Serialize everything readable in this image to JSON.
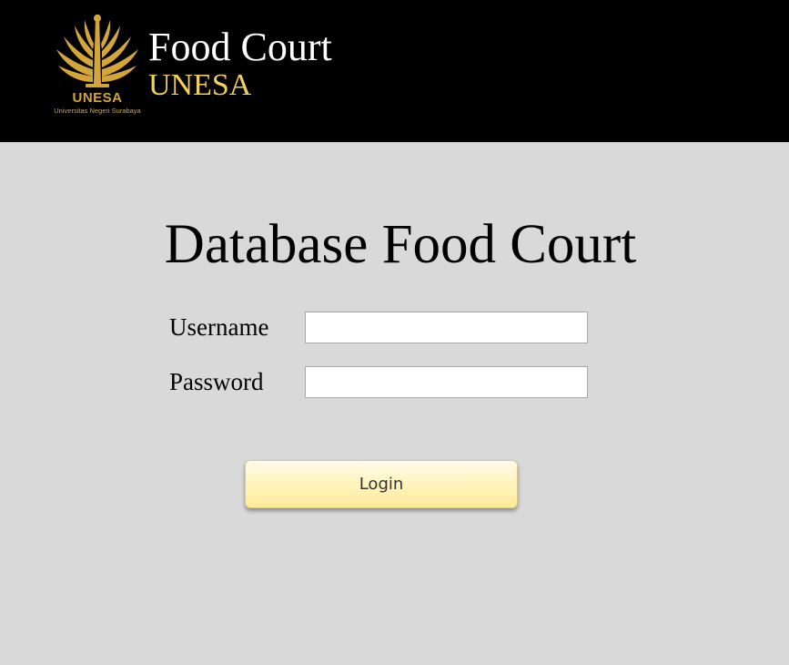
{
  "header": {
    "logo": {
      "icon": "unesa-emblem-icon",
      "wordmark": "UNESA",
      "subtitle": "Universitas Negeri Surabaya",
      "color": "#d4a63a"
    },
    "title": "Food Court",
    "subtitle": "UNESA",
    "subtitle_color": "#f3cf5c",
    "background": "#000000"
  },
  "main": {
    "title": "Database Food Court",
    "background": "#d9d9d9",
    "form": {
      "username_label": "Username",
      "username_value": "",
      "password_label": "Password",
      "password_value": "",
      "login_label": "Login"
    }
  }
}
